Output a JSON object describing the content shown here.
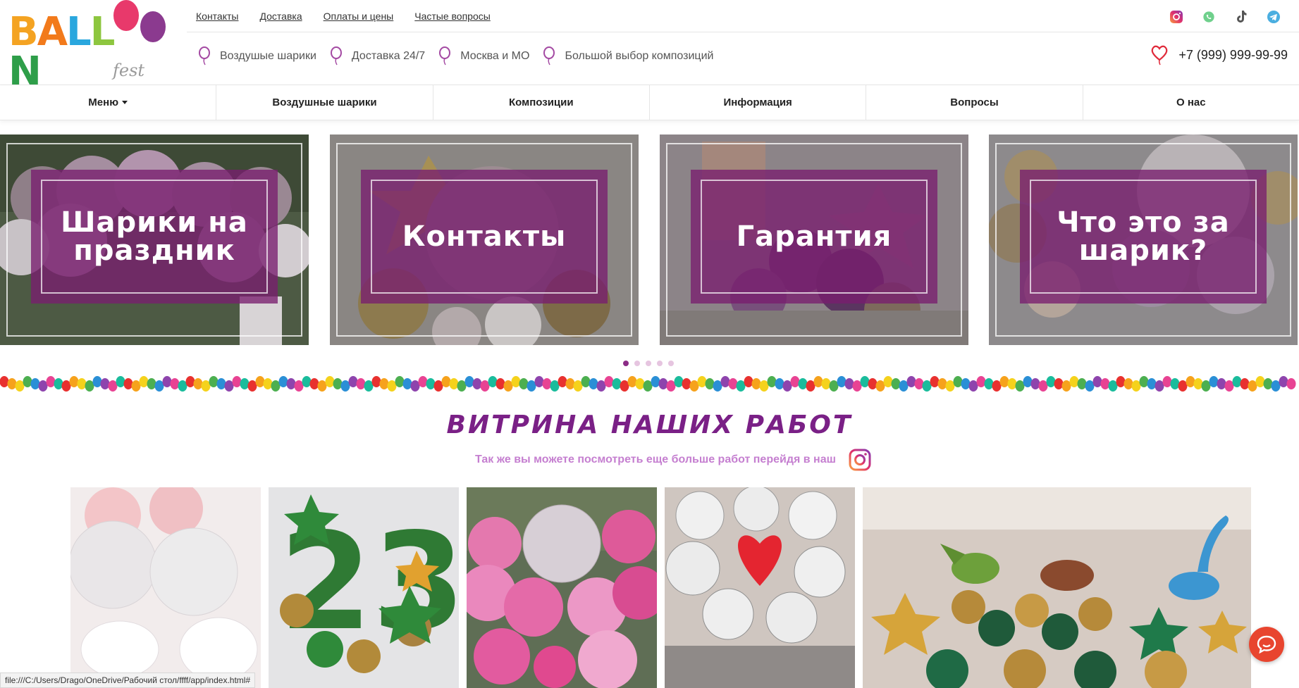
{
  "logo": {
    "letters": [
      "B",
      "A",
      "L",
      "L",
      "O",
      "O",
      "N"
    ],
    "letter_colors": [
      "#f4a322",
      "#f27a1b",
      "#2aa7de",
      "#8dc63f",
      "#e8396b",
      "#8b3a8f",
      "#2e9e49"
    ],
    "script": "fest"
  },
  "top_links": [
    "Контакты",
    "Доставка",
    "Оплаты и цены",
    "Частые вопросы"
  ],
  "social": [
    {
      "icon": "instagram-icon",
      "color": "#c13584"
    },
    {
      "icon": "whatsapp-icon",
      "color": "#25d366"
    },
    {
      "icon": "tiktok-icon",
      "color": "#333333"
    },
    {
      "icon": "telegram-icon",
      "color": "#2aa0da"
    }
  ],
  "features": [
    "Воздушые шарики",
    "Доставка 24/7",
    "Москва и МО",
    "Большой выбор композиций"
  ],
  "phone": "+7 (999) 999-99-99",
  "nav": [
    "Меню",
    "Воздушные шарики",
    "Композиции",
    "Информация",
    "Вопросы",
    "О нас"
  ],
  "slides": [
    {
      "title": "Шарики на праздник"
    },
    {
      "title": "Контакты"
    },
    {
      "title": "Гарантия"
    },
    {
      "title": "Что это за шарик?"
    }
  ],
  "slider_dots": 5,
  "slider_active": 0,
  "showcase": {
    "title": "ВИТРИНА НАШИХ РАБОТ",
    "subtitle": "Так же вы можете посмотреть еще больше работ перейдя в наш"
  },
  "status_url": "file:///C:/Users/Drago/OneDrive/Рабочий стол/ffff/app/index.html#",
  "colors": {
    "brand_purple": "#7a2086",
    "accent_red": "#e8452f",
    "pink_sub": "#c57fd0"
  }
}
